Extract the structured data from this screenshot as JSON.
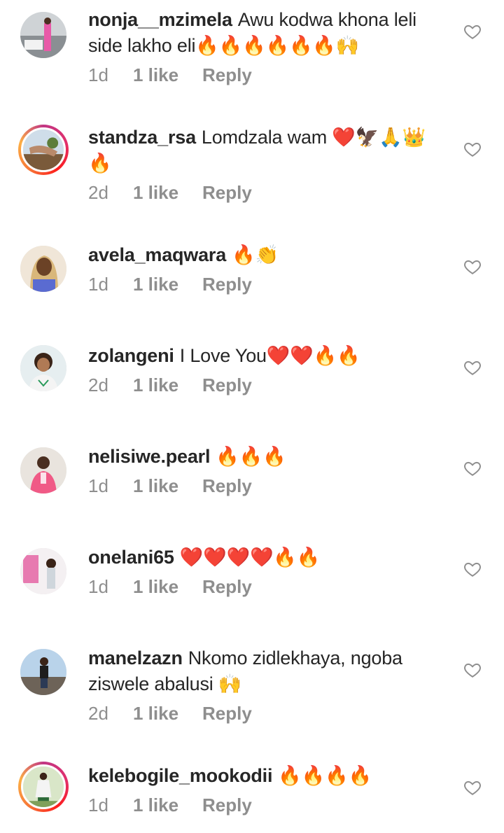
{
  "comments": [
    {
      "username": "nonja__mzimela",
      "text": "Awu kodwa khona leli side lakho eli🔥🔥🔥🔥🔥🔥🙌",
      "time": "1d",
      "likes": "1 like",
      "reply": "Reply"
    },
    {
      "username": "standza_rsa",
      "text": "Lomdzala wam ❤️🦅🙏👑🔥",
      "time": "2d",
      "likes": "1 like",
      "reply": "Reply"
    },
    {
      "username": "avela_maqwara",
      "text": "🔥👏",
      "time": "1d",
      "likes": "1 like",
      "reply": "Reply"
    },
    {
      "username": "zolangeni",
      "text": "I Love You❤️❤️🔥🔥",
      "time": "2d",
      "likes": "1 like",
      "reply": "Reply"
    },
    {
      "username": "nelisiwe.pearl",
      "text": "🔥🔥🔥",
      "time": "1d",
      "likes": "1 like",
      "reply": "Reply"
    },
    {
      "username": "onelani65",
      "text": "❤️❤️❤️❤️🔥🔥",
      "time": "1d",
      "likes": "1 like",
      "reply": "Reply"
    },
    {
      "username": "manelzazn",
      "text": "Nkomo zidlekhaya, ngoba ziswele abalusi 🙌",
      "time": "2d",
      "likes": "1 like",
      "reply": "Reply"
    },
    {
      "username": "kelebogile_mookodii",
      "text": "🔥🔥🔥🔥",
      "time": "1d",
      "likes": "1 like",
      "reply": "Reply"
    }
  ],
  "icons": {
    "like": "heart-outline-icon"
  },
  "colors": {
    "text": "#262626",
    "meta": "#8e8e8e",
    "story_ring": "#e1306c"
  }
}
